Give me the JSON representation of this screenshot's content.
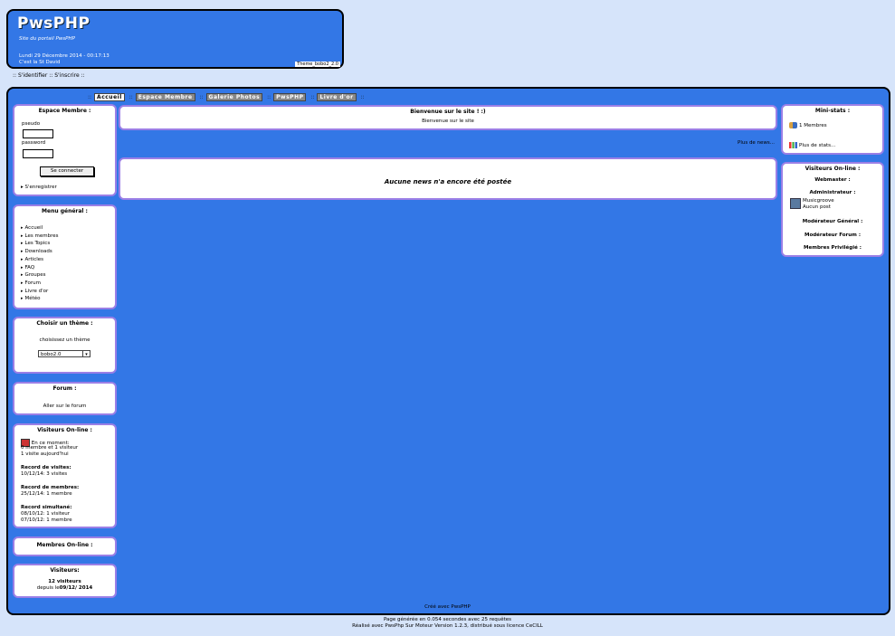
{
  "header": {
    "title": "PwsPHP",
    "subtitle": "Site du portail PwsPHP",
    "date": "Lundi 29 Décembre 2014 - 00:17:13",
    "saint": "C'est la St David",
    "theme": "Theme_bobo2_2.0"
  },
  "auth": {
    "login": ":: S'identifier ::",
    "register": "S'inscrire ::"
  },
  "topnav": {
    "tabs": [
      "Accueil",
      "Espace Membre",
      "Galerie Photos",
      "PwsPHP",
      "Livre d'or"
    ]
  },
  "member_space": {
    "title": "Espace Membre :",
    "pseudo_label": "pseudo",
    "password_label": "password",
    "login_button": "Se connecter",
    "register_link": "S'enregistrer"
  },
  "general_menu": {
    "title": "Menu général :",
    "items": [
      "Accueil",
      "Les membres",
      "Les Topics",
      "Downloads",
      "Articles",
      "FAQ",
      "Groupes",
      "Forum",
      "Livre d'or",
      "Météo"
    ]
  },
  "theme_chooser": {
    "title": "Choisir un thème :",
    "prompt": "choisissez un thème",
    "selected": "bobo2.0"
  },
  "forum_box": {
    "title": "Forum :",
    "link": "Aller sur le forum"
  },
  "visitors_online_left": {
    "title": "Visiteurs On-line :",
    "now": "En ce moment:",
    "now_counts": "0 membre et 1 visiteur",
    "today": "1 visite aujourd'hui",
    "record_visits_label": "Record de visites:",
    "record_visits": "10/12/14: 3 visites",
    "record_members_label": "Record de membres:",
    "record_members": "25/12/14: 1 membre",
    "record_sim_label": "Record simultané:",
    "record_sim_1": "08/10/12: 1 visiteur",
    "record_sim_2": "07/10/12: 1 membre"
  },
  "members_online": {
    "title": "Membres On-line :"
  },
  "visitors_box": {
    "title": "Visiteurs:",
    "count": "12 visiteurs",
    "since_prefix": "depuis le",
    "since_date": "09/12/ 2014"
  },
  "welcome": {
    "title": "Bienvenue sur le site ! :)",
    "text": "Bienvenue sur le site",
    "more_news": "Plus de news..."
  },
  "news": {
    "empty": "Aucune news n'a encore été postée"
  },
  "mini_stats": {
    "title": "Mini-stats :",
    "members": "1 Membres",
    "more": "Plus de stats..."
  },
  "visitors_online_right": {
    "title": "Visiteurs On-line :",
    "webmaster": "Webmaster :",
    "admin": "Administrateur :",
    "admin_user": "Musicgroove",
    "admin_post": "Aucun post",
    "general_mod": "Modérateur Général :",
    "forum_mod": "Modérateur Forum :",
    "privileged": "Membres Privilégié :"
  },
  "footer": {
    "created": "Créé avec PwsPHP",
    "generated": "Page générée en 0.054 secondes avec 25 requêtes",
    "credits": "Réalisé avec PwsPhp Sur Moteur Version 1.2.3, distribué sous licence CeCILL"
  },
  "colors": {
    "background": "#d6e4fa",
    "frame": "#3377e6",
    "box_border": "#9b7fe6"
  }
}
